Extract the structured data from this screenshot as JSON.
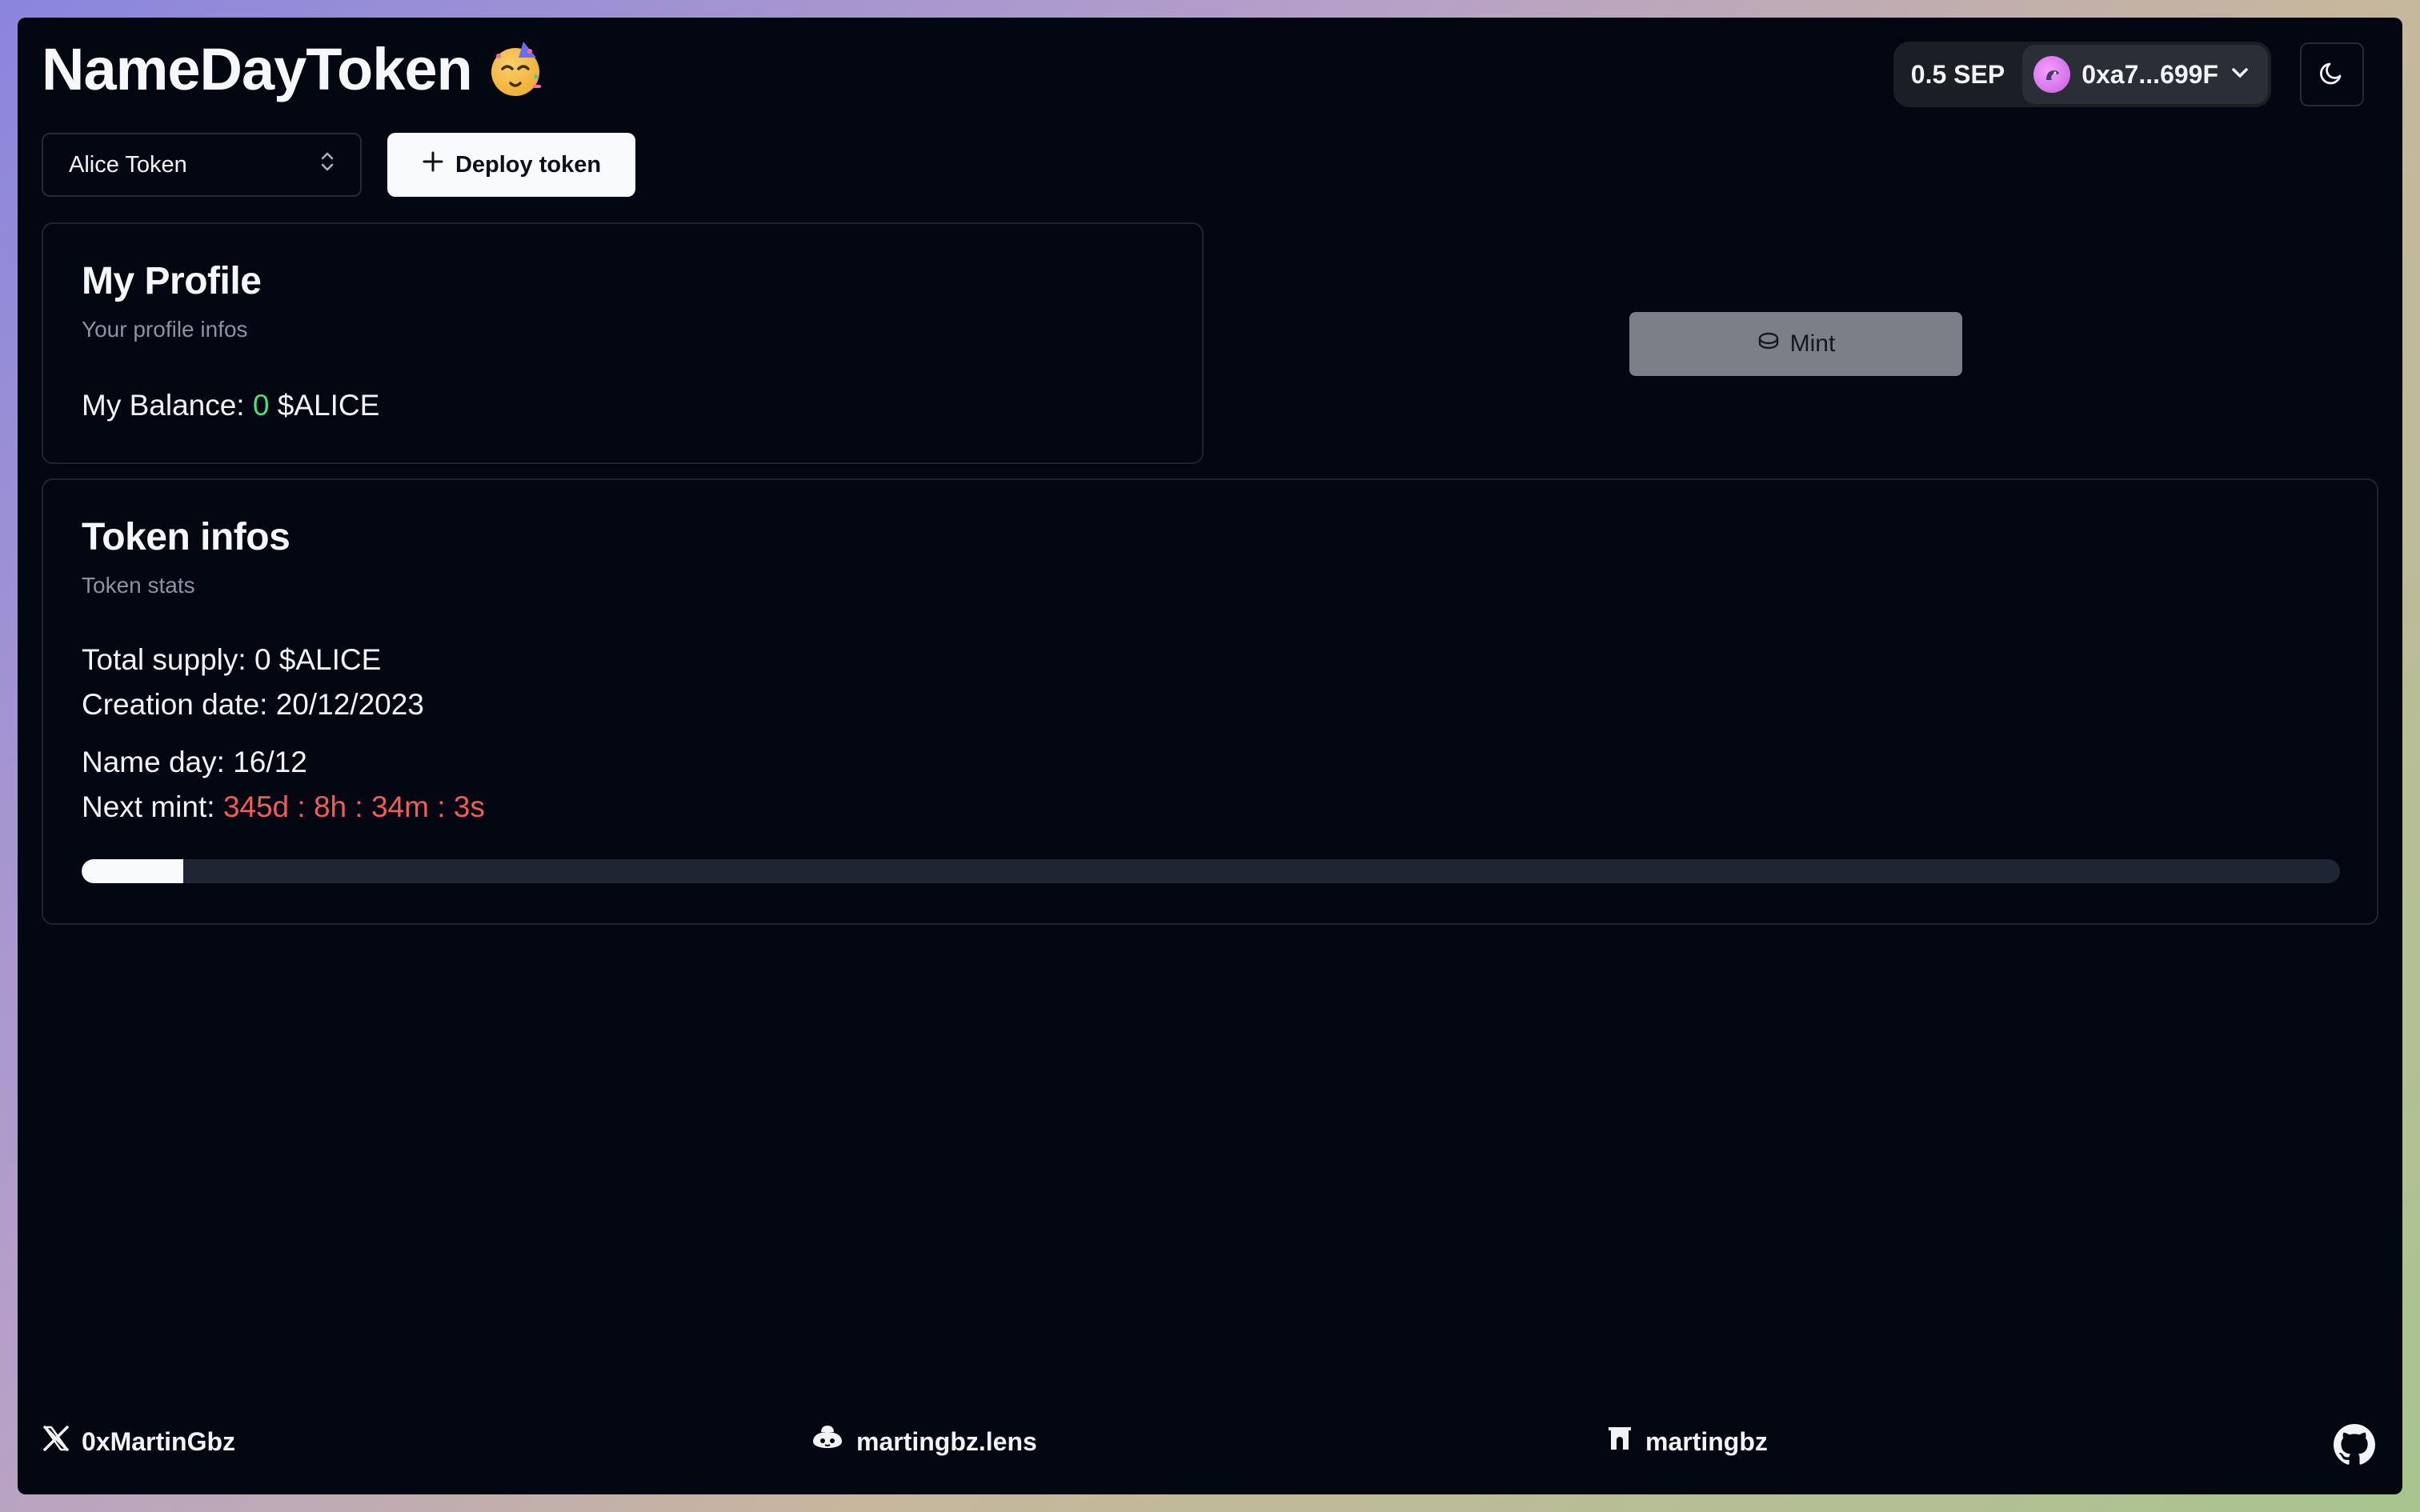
{
  "header": {
    "title": "NameDayToken",
    "title_emoji": "partying-face-emoji"
  },
  "wallet": {
    "balance": "0.5 SEP",
    "address": "0xa7...699F"
  },
  "controls": {
    "token_select_value": "Alice Token",
    "deploy_label": "Deploy token"
  },
  "profile": {
    "title": "My Profile",
    "subtitle": "Your profile infos",
    "balance_label": "My Balance:",
    "balance_value": "0",
    "balance_unit": "$ALICE"
  },
  "mint": {
    "label": "Mint"
  },
  "token_infos": {
    "title": "Token infos",
    "subtitle": "Token stats",
    "total_supply": "Total supply: 0 $ALICE",
    "creation_date": "Creation date: 20/12/2023",
    "name_day": "Name day: 16/12",
    "next_mint_label": "Next mint:",
    "next_mint_value": "345d : 8h : 34m : 3s",
    "progress_fraction": 0.045
  },
  "footer": {
    "twitter": "0xMartinGbz",
    "lens": "martingbz.lens",
    "farcaster": "martingbz"
  },
  "colors": {
    "background": "#030712",
    "accent_green": "#4ade80",
    "accent_red": "#f25b5b"
  }
}
